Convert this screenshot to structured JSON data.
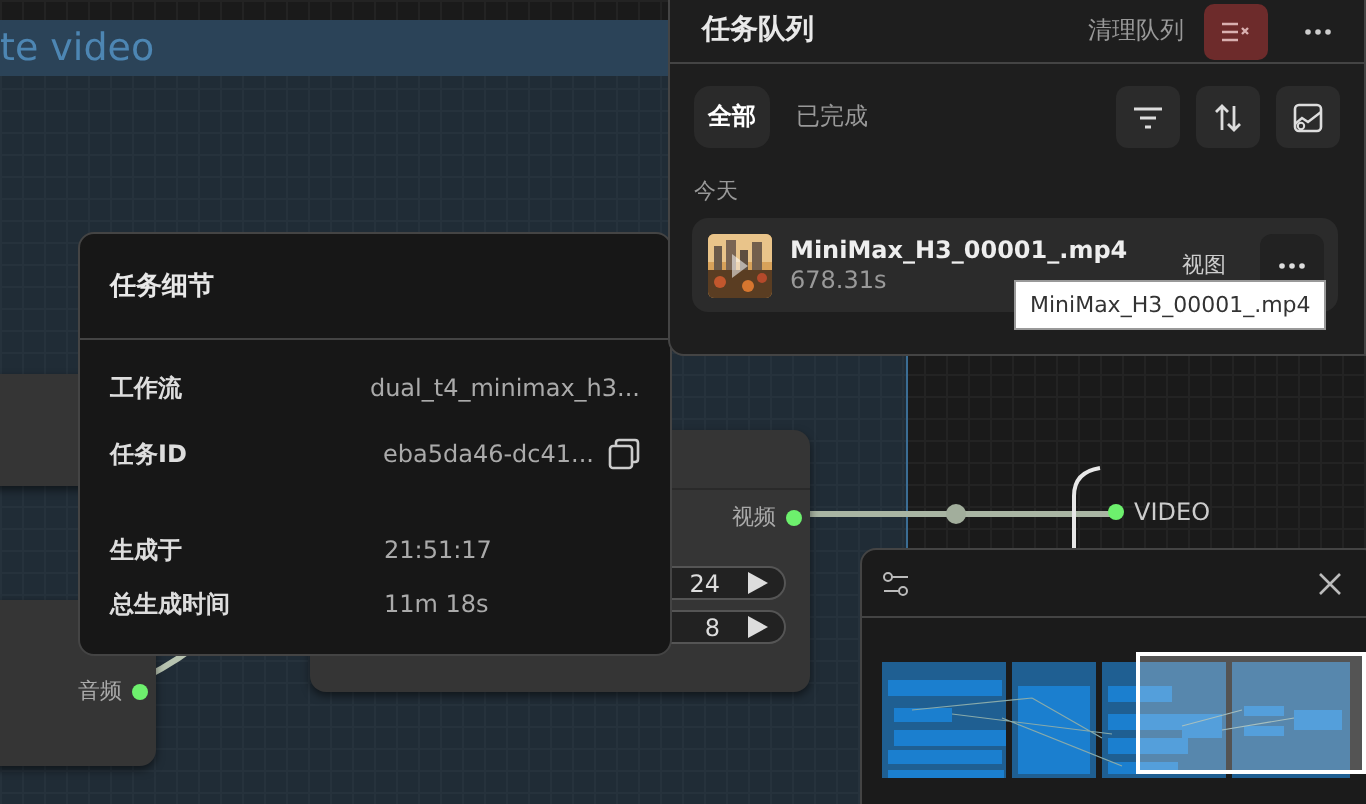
{
  "canvas": {
    "group_title": "te video",
    "nodes": [
      {
        "kind": "plain"
      },
      {
        "kind": "output",
        "outputs": [
          {
            "label": "音频"
          }
        ]
      },
      {
        "kind": "widgets",
        "outputs": [
          {
            "label": "视频"
          }
        ],
        "widgets": [
          {
            "value": "24"
          },
          {
            "value": "8"
          }
        ]
      },
      {
        "kind": "input",
        "inputs": [
          {
            "label": "VIDEO"
          }
        ]
      }
    ]
  },
  "task_detail": {
    "title": "任务细节",
    "fields": [
      {
        "label": "工作流",
        "value": "dual_t4_minimax_h3...",
        "copyable": false
      },
      {
        "label": "任务ID",
        "value": "eba5da46-dc41...",
        "copyable": true
      },
      {
        "label": "生成于",
        "value": "21:51:17",
        "copyable": false
      },
      {
        "label": "总生成时间",
        "value": "11m 18s",
        "copyable": false
      }
    ]
  },
  "queue": {
    "title": "任务队列",
    "clear_label": "清理队列",
    "tabs": [
      {
        "label": "全部",
        "selected": true
      },
      {
        "label": "已完成",
        "selected": false
      }
    ],
    "section": "今天",
    "items": [
      {
        "name": "MiniMax_H3_00001_.mp4",
        "duration": "678.31s",
        "action": "视图"
      }
    ],
    "tooltip": "MiniMax_H3_00001_.mp4"
  }
}
